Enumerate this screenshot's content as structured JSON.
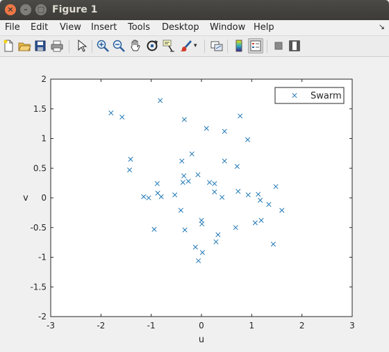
{
  "window": {
    "title": "Figure 1"
  },
  "menu": [
    "File",
    "Edit",
    "View",
    "Insert",
    "Tools",
    "Desktop",
    "Window",
    "Help"
  ],
  "toolbar": {
    "tools": [
      "new-figure-icon",
      "open-file-icon",
      "save-icon",
      "print-icon",
      "pointer-icon",
      "zoom-in-icon",
      "zoom-out-icon",
      "pan-hand-icon",
      "rotate-3d-icon",
      "data-cursor-icon",
      "brush-icon",
      "link-plot-icon",
      "colorbar-icon",
      "legend-icon",
      "hide-plot-tools-icon",
      "show-plot-tools-icon"
    ]
  },
  "chart_data": {
    "type": "scatter",
    "xlabel": "u",
    "ylabel": "v",
    "xlim": [
      -3,
      3
    ],
    "ylim": [
      -2,
      2
    ],
    "xticks": [
      "-3",
      "-2",
      "-1",
      "0",
      "1",
      "2",
      "3"
    ],
    "yticks": [
      "-2",
      "-1.5",
      "-1",
      "-0.5",
      "0",
      "0.5",
      "1",
      "1.5",
      "2"
    ],
    "marker": "x",
    "color": "#1f77b4",
    "legend": {
      "entries": [
        "Swarm"
      ],
      "position": "top-right"
    },
    "series": [
      {
        "name": "Swarm",
        "points": [
          [
            -1.8,
            1.43
          ],
          [
            -1.58,
            1.36
          ],
          [
            -0.82,
            1.64
          ],
          [
            -0.34,
            1.32
          ],
          [
            0.1,
            1.17
          ],
          [
            0.46,
            1.12
          ],
          [
            0.77,
            1.38
          ],
          [
            0.92,
            0.98
          ],
          [
            -1.41,
            0.65
          ],
          [
            -1.43,
            0.47
          ],
          [
            -0.19,
            0.74
          ],
          [
            -0.39,
            0.62
          ],
          [
            0.46,
            0.62
          ],
          [
            0.71,
            0.53
          ],
          [
            -0.88,
            0.24
          ],
          [
            -0.35,
            0.37
          ],
          [
            -0.26,
            0.28
          ],
          [
            -0.37,
            0.26
          ],
          [
            -0.07,
            0.39
          ],
          [
            0.16,
            0.26
          ],
          [
            0.26,
            0.24
          ],
          [
            0.26,
            0.1
          ],
          [
            -1.15,
            0.02
          ],
          [
            -1.05,
            0.0
          ],
          [
            -0.87,
            0.08
          ],
          [
            -0.8,
            0.02
          ],
          [
            -0.53,
            0.05
          ],
          [
            0.41,
            0.01
          ],
          [
            0.73,
            0.11
          ],
          [
            0.93,
            0.05
          ],
          [
            1.13,
            0.06
          ],
          [
            1.17,
            -0.04
          ],
          [
            1.34,
            -0.11
          ],
          [
            1.48,
            0.19
          ],
          [
            1.6,
            -0.21
          ],
          [
            -0.41,
            -0.21
          ],
          [
            -0.94,
            -0.53
          ],
          [
            -0.33,
            -0.54
          ],
          [
            0.0,
            -0.38
          ],
          [
            0.01,
            -0.44
          ],
          [
            0.68,
            -0.5
          ],
          [
            1.07,
            -0.42
          ],
          [
            1.19,
            -0.38
          ],
          [
            0.33,
            -0.62
          ],
          [
            0.29,
            -0.74
          ],
          [
            1.43,
            -0.78
          ],
          [
            -0.12,
            -0.83
          ],
          [
            0.02,
            -0.92
          ],
          [
            -0.06,
            -1.06
          ]
        ]
      }
    ]
  }
}
